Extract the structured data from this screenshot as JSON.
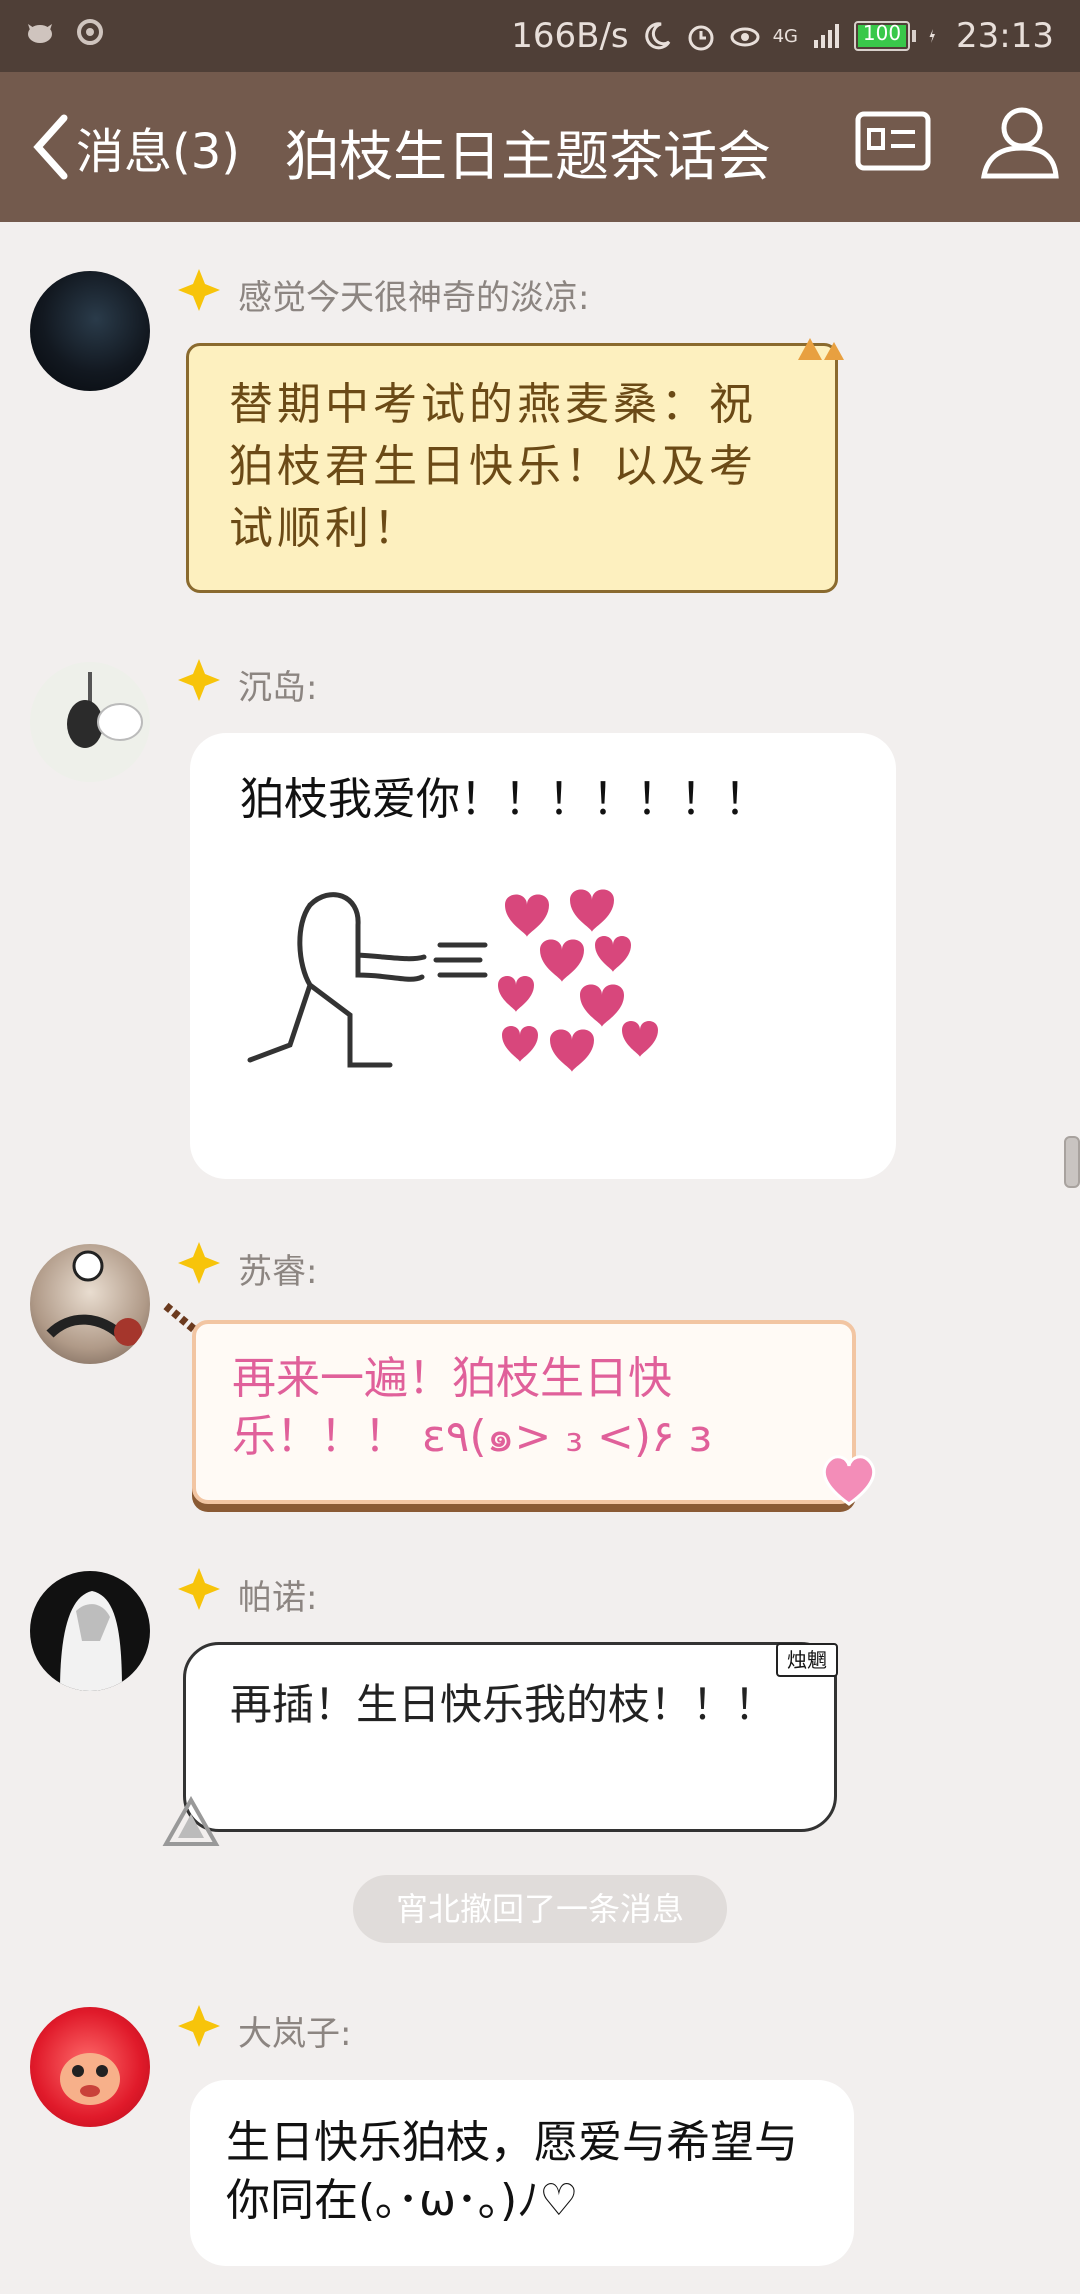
{
  "status_bar": {
    "net_speed": "166B/s",
    "network": "4G",
    "battery": "100",
    "time": "23:13"
  },
  "title_bar": {
    "back_label": "消息(3)",
    "title": "狛枝生日主题茶话会",
    "profile_card_icon": "id-card-icon",
    "members_icon": "person-icon"
  },
  "messages": [
    {
      "sender": "感觉今天很神奇的淡凉:",
      "text": "替期中考试的燕麦桑：祝狛枝君生日快乐！以及考试顺利！"
    },
    {
      "sender": "沉岛:",
      "text": "狛枝我爱你！！！！！！！",
      "sticker": "sending-hearts-sticker"
    },
    {
      "sender": "苏睿:",
      "text": "再来一遍！狛枝生日快乐！！！ ε٩(๑> ₃ <)۶ з"
    },
    {
      "sender": "帕诺:",
      "text": "再插！生日快乐我的枝！！！",
      "bubble_tag": "烛魍"
    },
    {
      "sender": "大岚子:",
      "text": "生日快乐狛枝，愿爱与希望与你同在(｡･ω･｡)ﾉ♡"
    }
  ],
  "recall_notice": "宵北撤回了一条消息",
  "colors": {
    "status_bar": "#4f3f37",
    "title_bar": "#735a4d",
    "background": "#f2efee",
    "pink_text": "#e0609a",
    "scroll_text": "#6b4a16"
  }
}
